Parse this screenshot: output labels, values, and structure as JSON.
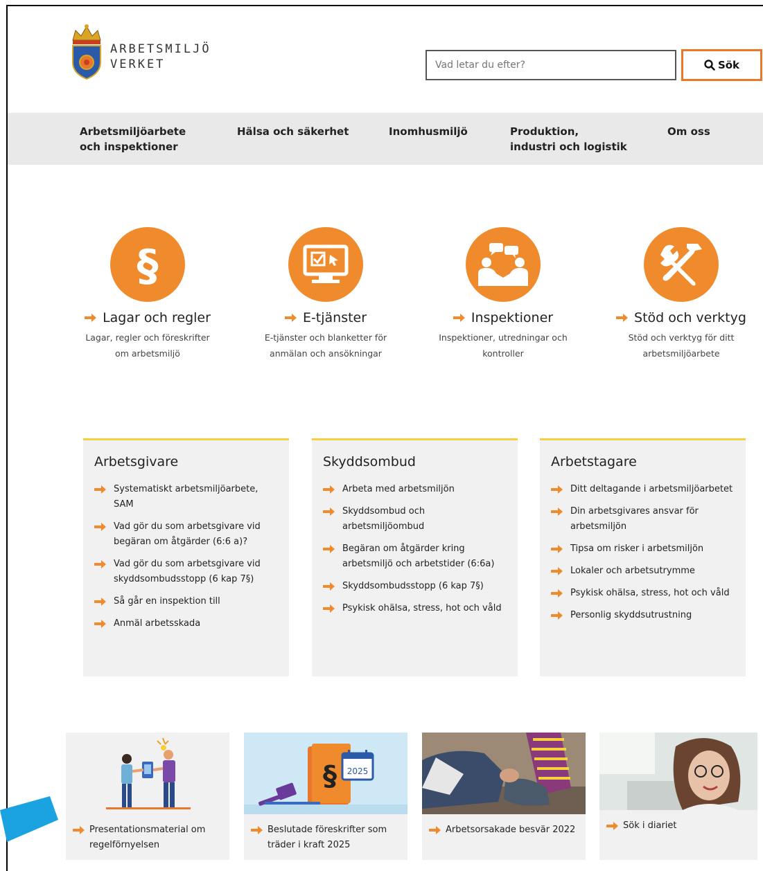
{
  "header": {
    "logo_line1": "ARBETSMILJÖ",
    "logo_line2": "VERKET",
    "search_placeholder": "Vad letar du efter?",
    "search_button": "Sök"
  },
  "nav": [
    {
      "label_1": "Arbetsmiljöarbete",
      "label_2": "och inspektioner"
    },
    {
      "label_1": "Hälsa och säkerhet",
      "label_2": ""
    },
    {
      "label_1": "Inomhusmiljö",
      "label_2": ""
    },
    {
      "label_1": "Produktion,",
      "label_2": "industri och logistik"
    },
    {
      "label_1": "Om oss",
      "label_2": ""
    }
  ],
  "icons": [
    {
      "title": "Lagar och regler",
      "desc_1": "Lagar, regler och föreskrifter",
      "desc_2": "om arbetsmiljö",
      "icon": "paragraph-icon"
    },
    {
      "title": "E-tjänster",
      "desc_1": "E-tjänster och blanketter för",
      "desc_2": "anmälan och ansökningar",
      "icon": "computer-icon"
    },
    {
      "title": "Inspektioner",
      "desc_1": "Inspektioner, utredningar och",
      "desc_2": "kontroller",
      "icon": "people-chat-icon"
    },
    {
      "title": "Stöd och verktyg",
      "desc_1": "Stöd och verktyg för ditt",
      "desc_2": "arbetsmiljöarbete",
      "icon": "tools-icon"
    }
  ],
  "boxes": [
    {
      "title": "Arbetsgivare",
      "items": [
        "Systematiskt arbetsmiljöarbete, SAM",
        "Vad gör du som arbetsgivare vid begäran om åtgärder (6:6 a)?",
        "Vad gör du som arbetsgivare vid skyddsombudsstopp (6 kap 7§)",
        "Så går en inspektion till",
        "Anmäl arbetsskada"
      ]
    },
    {
      "title": "Skyddsombud",
      "items": [
        "Arbeta med arbetsmiljön",
        "Skyddsombud och arbetsmiljöombud",
        "Begäran om åtgärder kring arbetsmiljö och arbetstider (6:6a)",
        "Skyddsombudsstopp (6 kap 7§)",
        "Psykisk ohälsa, stress, hot och våld"
      ]
    },
    {
      "title": "Arbetstagare",
      "items": [
        "Ditt deltagande i arbetsmiljöarbetet",
        "Din arbetsgivares ansvar för arbetsmiljön",
        "Tipsa om risker i arbetsmiljön",
        "Lokaler och arbetsutrymme",
        "Psykisk ohälsa, stress, hot och våld",
        "Personlig skyddsutrustning"
      ]
    }
  ],
  "cards": [
    {
      "label": "Presentationsmaterial om regelförnyelsen"
    },
    {
      "label": "Beslutade föreskrifter som träder i kraft 2025",
      "calendar_year": "2025"
    },
    {
      "label": "Arbetsorsakade besvär 2022"
    },
    {
      "label": "Sök i diariet"
    }
  ],
  "colors": {
    "accent": "#ef8b2c",
    "box_border": "#f5cf3c",
    "nav_bg": "#e9e9e9",
    "annotation": "#1aa3e0"
  }
}
